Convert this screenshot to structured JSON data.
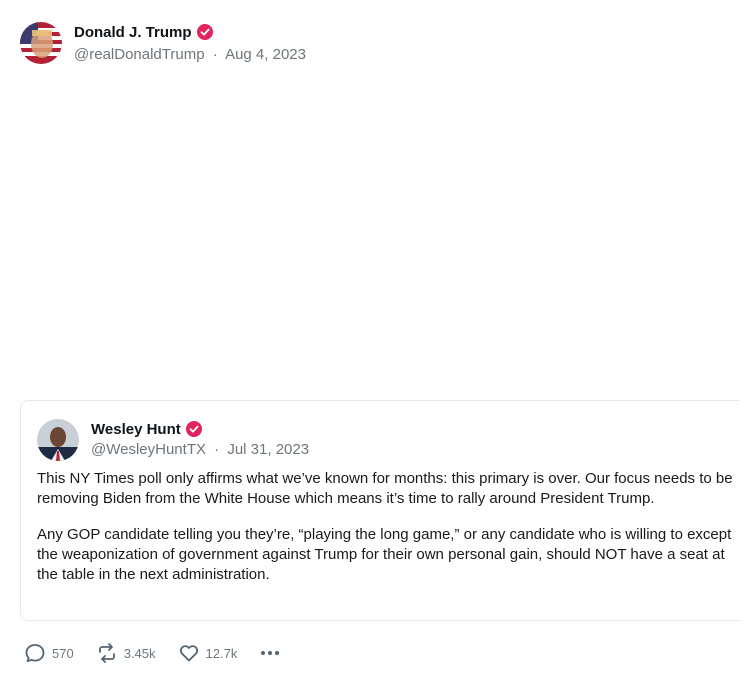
{
  "post": {
    "author_name": "Donald J. Trump",
    "handle": "@realDonaldTrump",
    "separator": "·",
    "date": "Aug 4, 2023",
    "verified": true
  },
  "quote": {
    "author_name": "Wesley Hunt",
    "handle": "@WesleyHuntTX",
    "separator": "·",
    "date": "Jul 31, 2023",
    "verified": true,
    "paragraphs": [
      "This NY Times poll only affirms what we’ve known for months: this primary is over.  Our focus needs to be removing Biden from the White House which means it’s time to rally around President Trump.",
      "Any GOP candidate telling you they’re, “playing the long game,” or any candidate who is willing to except the weaponization of government against Trump for their own personal gain, should NOT have a seat at the table in the next administration."
    ]
  },
  "actions": {
    "replies": "570",
    "reposts": "3.45k",
    "likes": "12.7k",
    "more_icon": "ellipsis-icon"
  },
  "colors": {
    "verified_badge": "#e0245e",
    "meta_text": "#6e767d",
    "card_border": "#e6e8ea"
  }
}
